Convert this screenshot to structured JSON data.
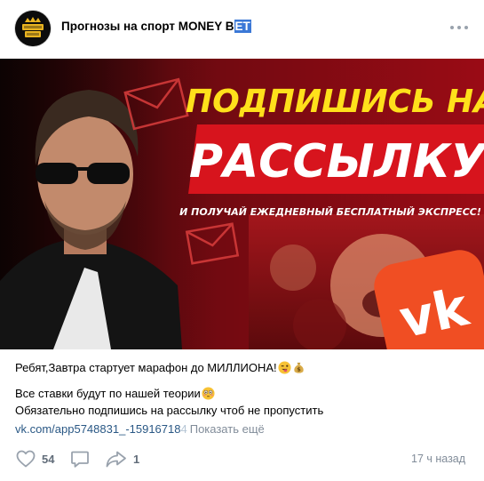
{
  "post": {
    "author_prefix": "Прогнозы на спорт MONEY B",
    "author_highlight": "ET",
    "banner": {
      "line1": "ПОДПИШИСЬ НА",
      "line2": "РАССЫЛКУ",
      "line3": "И ПОЛУЧАЙ ЕЖЕДНЕВНЫЙ БЕСПЛАТНЫЙ ЭКСПРЕСС!"
    },
    "text_line1": "Ребят,Завтра стартует марафон до МИЛЛИОНА!",
    "text_line2": "Все ставки будут по нашей теории",
    "text_line3": "Обязательно подпишись на рассылку чтоб не пропустить",
    "link_text": "vk.com/app5748831_-15916718",
    "link_fade": "4",
    "show_more": "Показать ещё",
    "likes": "54",
    "shares": "1",
    "time": "17 ч назад"
  },
  "icons": {
    "avatar": "money-bet-logo",
    "more": "more-dots-icon",
    "like": "heart-icon",
    "comment": "comment-icon",
    "share": "share-icon"
  },
  "colors": {
    "banner_red": "#b3000f",
    "banner_yellow": "#ffe01b",
    "vk_orange": "#f04e23",
    "link": "#2a5885",
    "meta_gray": "#818c99"
  }
}
